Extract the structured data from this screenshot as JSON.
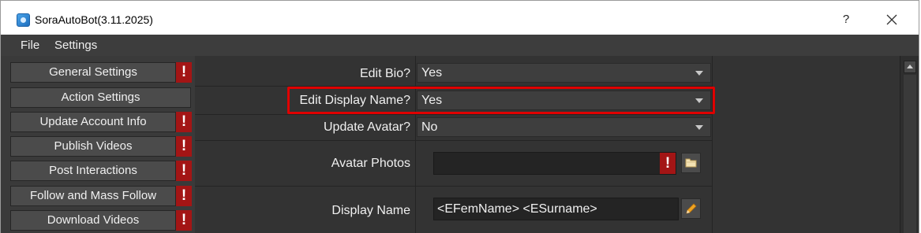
{
  "window": {
    "title": "SoraAutoBot(3.11.2025)",
    "help_label": "?",
    "close_label": "✕"
  },
  "menu": {
    "items": [
      {
        "label": "File"
      },
      {
        "label": "Settings"
      }
    ]
  },
  "sidebar": {
    "items": [
      {
        "label": "General Settings",
        "warning": true
      },
      {
        "label": "Action Settings",
        "warning": false
      },
      {
        "label": "Update Account Info",
        "warning": true
      },
      {
        "label": "Publish Videos",
        "warning": true
      },
      {
        "label": "Post Interactions",
        "warning": true
      },
      {
        "label": "Follow and Mass Follow",
        "warning": true
      },
      {
        "label": "Download Videos",
        "warning": true
      }
    ],
    "warning_glyph": "!"
  },
  "form": {
    "edit_bio": {
      "label": "Edit Bio?",
      "value": "Yes"
    },
    "edit_display_name": {
      "label": "Edit Display Name?",
      "value": "Yes"
    },
    "update_avatar": {
      "label": "Update Avatar?",
      "value": "No"
    },
    "avatar_photos": {
      "label": "Avatar Photos",
      "value": "",
      "warning": "!"
    },
    "display_name": {
      "label": "Display Name",
      "value": "<EFemName> <ESurname>"
    }
  },
  "colors": {
    "highlight": "#e00000",
    "warning": "#a31515",
    "panel": "#333333",
    "menubar": "#3d3d3d"
  },
  "icons": {
    "app": "app-logo-icon",
    "folder": "folder-icon",
    "edit": "pencil-icon"
  }
}
